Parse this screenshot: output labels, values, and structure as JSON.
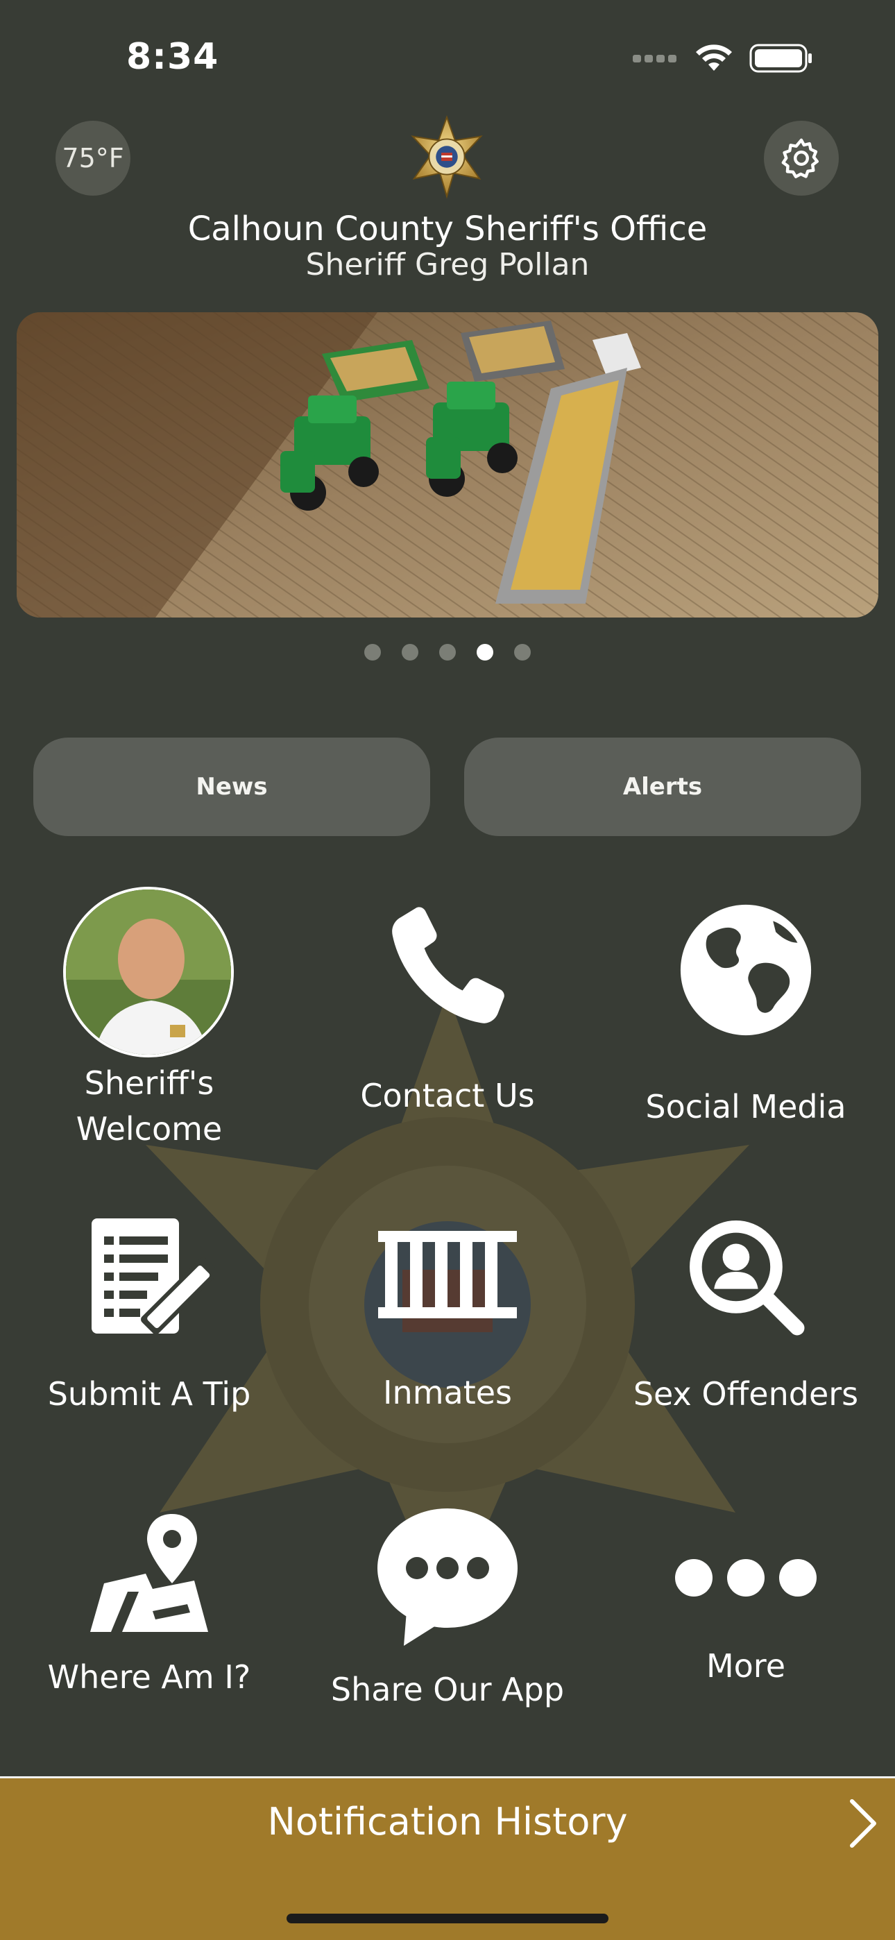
{
  "status_bar": {
    "time": "8:34"
  },
  "header": {
    "temperature": "75°F",
    "title": "Calhoun County Sheriff's Office",
    "subtitle": "Sheriff Greg Pollan"
  },
  "carousel": {
    "page_count": 5,
    "active_index": 3
  },
  "buttons": {
    "news": "News",
    "alerts": "Alerts"
  },
  "grid": [
    {
      "label": "Sheriff's\nWelcome",
      "icon": "sheriff-portrait"
    },
    {
      "label": "Contact Us",
      "icon": "phone-icon"
    },
    {
      "label": "Social Media",
      "icon": "globe-icon"
    },
    {
      "label": "Submit A Tip",
      "icon": "notepad-pencil-icon"
    },
    {
      "label": "Inmates",
      "icon": "jail-bars-icon"
    },
    {
      "label": "Sex Offenders",
      "icon": "search-person-icon"
    },
    {
      "label": "Where Am I?",
      "icon": "map-pin-icon"
    },
    {
      "label": "Share Our App",
      "icon": "chat-bubble-icon"
    },
    {
      "label": "More",
      "icon": "more-dots-icon"
    }
  ],
  "notification_bar": {
    "label": "Notification History"
  },
  "colors": {
    "background": "#383c35",
    "accent_gold": "#a07a2a",
    "pill": "#5b5e58"
  }
}
